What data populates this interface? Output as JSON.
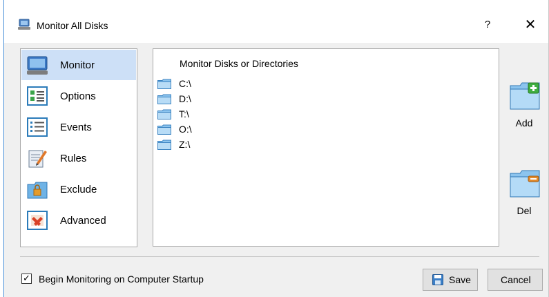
{
  "window": {
    "title": "Monitor All Disks",
    "help_label": "?",
    "close_label": "✕"
  },
  "nav": {
    "items": [
      {
        "label": "Monitor",
        "icon": "monitor-icon",
        "selected": true
      },
      {
        "label": "Options",
        "icon": "options-icon",
        "selected": false
      },
      {
        "label": "Events",
        "icon": "events-icon",
        "selected": false
      },
      {
        "label": "Rules",
        "icon": "rules-icon",
        "selected": false
      },
      {
        "label": "Exclude",
        "icon": "exclude-icon",
        "selected": false
      },
      {
        "label": "Advanced",
        "icon": "advanced-icon",
        "selected": false
      }
    ]
  },
  "list": {
    "header": "Monitor Disks or Directories",
    "rows": [
      "C:\\",
      "D:\\",
      "T:\\",
      "O:\\",
      "Z:\\"
    ]
  },
  "actions": {
    "add_label": "Add",
    "del_label": "Del"
  },
  "footer": {
    "startup_label": "Begin Monitoring on Computer Startup",
    "startup_checked": true,
    "save_label": "Save",
    "cancel_label": "Cancel"
  },
  "colors": {
    "selection": "#cde0f7",
    "folder": "#6fb3e6",
    "add_accent": "#3fae3f",
    "del_accent": "#e38a2b"
  }
}
